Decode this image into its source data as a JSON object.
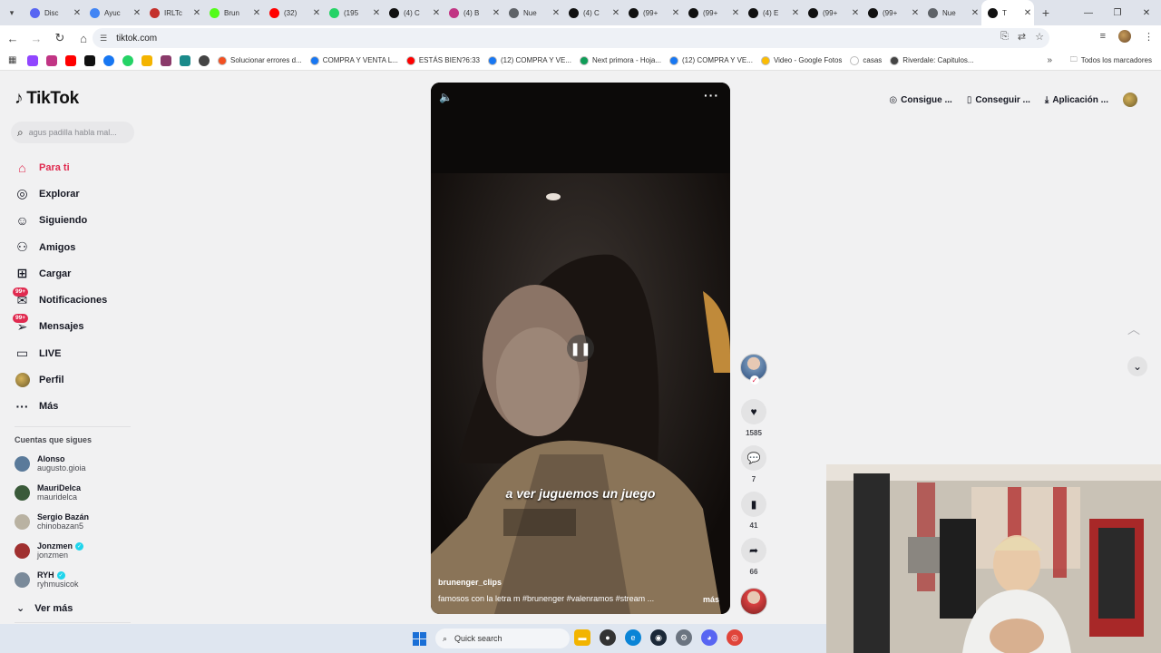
{
  "browser": {
    "tabs": [
      {
        "title": "Disc",
        "color": "#5865f2"
      },
      {
        "title": "Ayuc",
        "color": "#4285f4"
      },
      {
        "title": "IRLTc",
        "color": "#c4302b"
      },
      {
        "title": "Brun",
        "color": "#53fc18"
      },
      {
        "title": "(32)",
        "color": "#ff0000"
      },
      {
        "title": "(195",
        "color": "#25d366"
      },
      {
        "title": "(4) C",
        "color": "#111111"
      },
      {
        "title": "(4) B",
        "color": "#c13584"
      },
      {
        "title": "Nue",
        "color": "#5f6368"
      },
      {
        "title": "(4) C",
        "color": "#111111"
      },
      {
        "title": "(99+",
        "color": "#111111"
      },
      {
        "title": "(99+",
        "color": "#111111"
      },
      {
        "title": "(4) E",
        "color": "#111111"
      },
      {
        "title": "(99+",
        "color": "#111111"
      },
      {
        "title": "(99+",
        "color": "#111111"
      },
      {
        "title": "Nue",
        "color": "#5f6368"
      },
      {
        "title": "T",
        "color": "#111111",
        "active": true
      }
    ],
    "url": "tiktok.com",
    "bookmarks": [
      {
        "label": "Solucionar errores d...",
        "color": "#f25022"
      },
      {
        "label": "COMPRA Y VENTA L...",
        "color": "#1877f2"
      },
      {
        "label": "ESTÁS BIEN?6:33",
        "color": "#ff0000"
      },
      {
        "label": "(12) COMPRA Y VE...",
        "color": "#1877f2"
      },
      {
        "label": "Next primora - Hoja...",
        "color": "#0f9d58"
      },
      {
        "label": "(12) COMPRA Y VE...",
        "color": "#1877f2"
      },
      {
        "label": "Video - Google Fotos",
        "color": "#fbbc04"
      },
      {
        "label": "casas",
        "color": "#ffffff"
      },
      {
        "label": "Riverdale: Capitulos...",
        "color": "#444444"
      }
    ],
    "all_bookmarks": "Todos los marcadores"
  },
  "sidebar": {
    "logo": "TikTok",
    "search_placeholder": "agus padilla habla mal...",
    "nav": [
      {
        "label": "Para ti",
        "icon": "home-icon",
        "active": true
      },
      {
        "label": "Explorar",
        "icon": "compass-icon"
      },
      {
        "label": "Siguiendo",
        "icon": "following-icon"
      },
      {
        "label": "Amigos",
        "icon": "friends-icon"
      },
      {
        "label": "Cargar",
        "icon": "upload-icon"
      },
      {
        "label": "Notificaciones",
        "icon": "notifications-icon",
        "badge": "99+"
      },
      {
        "label": "Mensajes",
        "icon": "messages-icon",
        "badge": "99+"
      },
      {
        "label": "LIVE",
        "icon": "live-icon"
      },
      {
        "label": "Perfil",
        "icon": "profile-avatar"
      },
      {
        "label": "Más",
        "icon": "more-icon"
      }
    ],
    "following_title": "Cuentas que sigues",
    "following": [
      {
        "name": "Alonso",
        "username": "augusto.gioia",
        "verified": false,
        "color": "#5a7a9a"
      },
      {
        "name": "MauriDelca",
        "username": "mauridelca",
        "verified": false,
        "color": "#3a5a3a"
      },
      {
        "name": "Sergio Bazán",
        "username": "chinobazan5",
        "verified": false,
        "color": "#b9b2a2"
      },
      {
        "name": "Jonzmen",
        "username": "jonzmen",
        "verified": true,
        "color": "#a03030"
      },
      {
        "name": "RYH",
        "username": "ryhmusicok",
        "verified": true,
        "color": "#7a8a9a"
      }
    ],
    "see_more": "Ver más"
  },
  "video": {
    "caption": "a ver juguemos un juego",
    "author": "brunenger_clips",
    "description": "famosos con la letra m #brunenger #valenramos #stream ...",
    "more": "más"
  },
  "actions": {
    "likes": "1585",
    "comments": "7",
    "saves": "41",
    "shares": "66"
  },
  "header": {
    "coins": "Consigue ...",
    "get_app": "Conseguir ...",
    "download": "Aplicación ..."
  },
  "taskbar": {
    "search": "Quick search"
  }
}
